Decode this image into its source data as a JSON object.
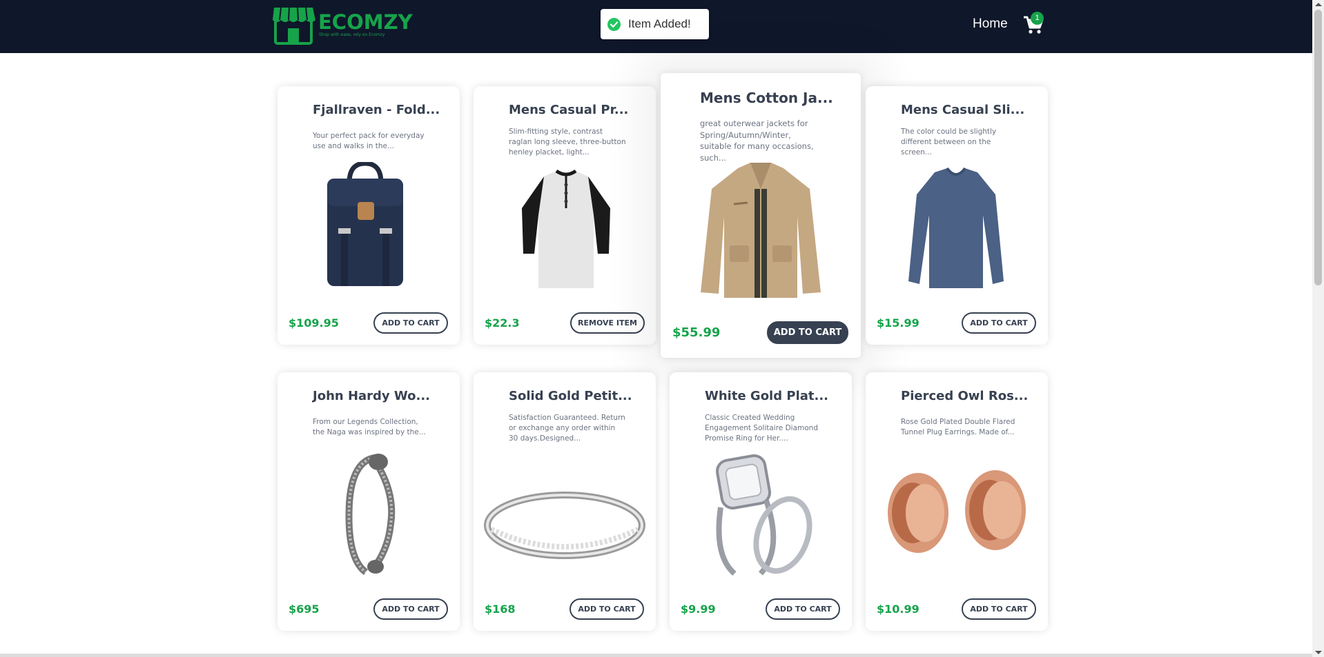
{
  "brand": {
    "name": "ECOMZY",
    "tagline": "Shop with ease, rely on Ecomzy",
    "color": "#16a34a"
  },
  "nav": {
    "home_label": "Home",
    "cart_icon": "shopping-cart-icon",
    "cart_count": "1"
  },
  "toast": {
    "icon": "check-circle-icon",
    "message": "Item Added!"
  },
  "products": [
    {
      "title": "Fjallraven - Fold...",
      "description": "Your perfect pack for everyday use and walks in the...",
      "price": "$109.95",
      "button": "ADD TO CART",
      "image": "backpack"
    },
    {
      "title": "Mens Casual Pr...",
      "description": "Slim-fitting style, contrast raglan long sleeve, three-button henley placket, light...",
      "price": "$22.3",
      "button": "REMOVE ITEM",
      "image": "henley-shirt"
    },
    {
      "title": "Mens Cotton Ja...",
      "description": "great outerwear jackets for Spring/Autumn/Winter, suitable for many occasions, such...",
      "price": "$55.99",
      "button": "ADD TO CART",
      "image": "cotton-jacket"
    },
    {
      "title": "Mens Casual Sli...",
      "description": "The color could be slightly different between on the screen...",
      "price": "$15.99",
      "button": "ADD TO CART",
      "image": "long-sleeve-tee"
    },
    {
      "title": "John Hardy Wo...",
      "description": "From our Legends Collection, the Naga was inspired by the...",
      "price": "$695",
      "button": "ADD TO CART",
      "image": "dragon-bracelet"
    },
    {
      "title": "Solid Gold Petit...",
      "description": "Satisfaction Guaranteed. Return or exchange any order within 30 days.Designed...",
      "price": "$168",
      "button": "ADD TO CART",
      "image": "gold-ring"
    },
    {
      "title": "White Gold Plat...",
      "description": "Classic Created Wedding Engagement Solitaire Diamond Promise Ring for Her....",
      "price": "$9.99",
      "button": "ADD TO CART",
      "image": "diamond-ring"
    },
    {
      "title": "Pierced Owl Ros...",
      "description": "Rose Gold Plated Double Flared Tunnel Plug Earrings. Made of...",
      "price": "$10.99",
      "button": "ADD TO CART",
      "image": "tunnel-plugs"
    }
  ]
}
